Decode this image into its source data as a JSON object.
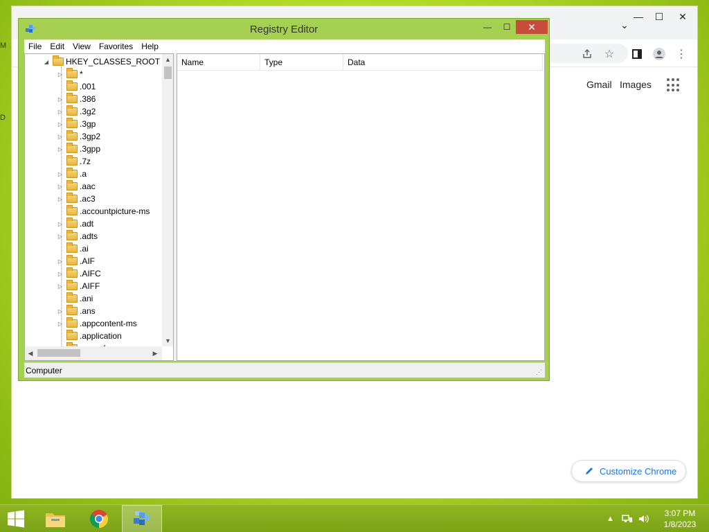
{
  "chrome": {
    "title_controls": {
      "minimize": "—",
      "maximize": "☐",
      "close": "✕"
    },
    "tab_overflow": "⌄",
    "toolbar_icons": [
      "share-icon",
      "star-icon",
      "side-panel-icon",
      "profile-icon",
      "more-icon"
    ],
    "links": {
      "gmail": "Gmail",
      "images": "Images"
    },
    "customize_label": "Customize Chrome",
    "edge_letters": [
      "M",
      "D"
    ]
  },
  "regedit": {
    "title": "Registry Editor",
    "window_controls": {
      "minimize": "—",
      "maximize": "☐",
      "close": "✕"
    },
    "menu": [
      "File",
      "Edit",
      "View",
      "Favorites",
      "Help"
    ],
    "tree": {
      "root": "HKEY_CLASSES_ROOT",
      "items": [
        {
          "label": "*",
          "expandable": true
        },
        {
          "label": ".001",
          "expandable": false
        },
        {
          "label": ".386",
          "expandable": true
        },
        {
          "label": ".3g2",
          "expandable": true
        },
        {
          "label": ".3gp",
          "expandable": true
        },
        {
          "label": ".3gp2",
          "expandable": true
        },
        {
          "label": ".3gpp",
          "expandable": true
        },
        {
          "label": ".7z",
          "expandable": false
        },
        {
          "label": ".a",
          "expandable": true
        },
        {
          "label": ".aac",
          "expandable": true
        },
        {
          "label": ".ac3",
          "expandable": true
        },
        {
          "label": ".accountpicture-ms",
          "expandable": false
        },
        {
          "label": ".adt",
          "expandable": true
        },
        {
          "label": ".adts",
          "expandable": true
        },
        {
          "label": ".ai",
          "expandable": false
        },
        {
          "label": ".AIF",
          "expandable": true
        },
        {
          "label": ".AIFC",
          "expandable": true
        },
        {
          "label": ".AIFF",
          "expandable": true
        },
        {
          "label": ".ani",
          "expandable": false
        },
        {
          "label": ".ans",
          "expandable": true
        },
        {
          "label": ".appcontent-ms",
          "expandable": true
        },
        {
          "label": ".application",
          "expandable": false
        },
        {
          "label": ".appref-ms",
          "expandable": true
        }
      ]
    },
    "columns": [
      "Name",
      "Type",
      "Data"
    ],
    "status": "Computer"
  },
  "taskbar": {
    "items": [
      "start-button",
      "file-explorer",
      "google-chrome",
      "registry-editor"
    ],
    "active": "registry-editor",
    "tray_overflow": "▲",
    "clock": {
      "time": "3:07 PM",
      "date": "1/8/2023"
    }
  },
  "colors": {
    "desktop": "#b7dc2a",
    "window_frame": "#a6d052",
    "taskbar": "#7aa316",
    "close_button": "#c74c3c",
    "chrome_link": "#1a73e8"
  }
}
